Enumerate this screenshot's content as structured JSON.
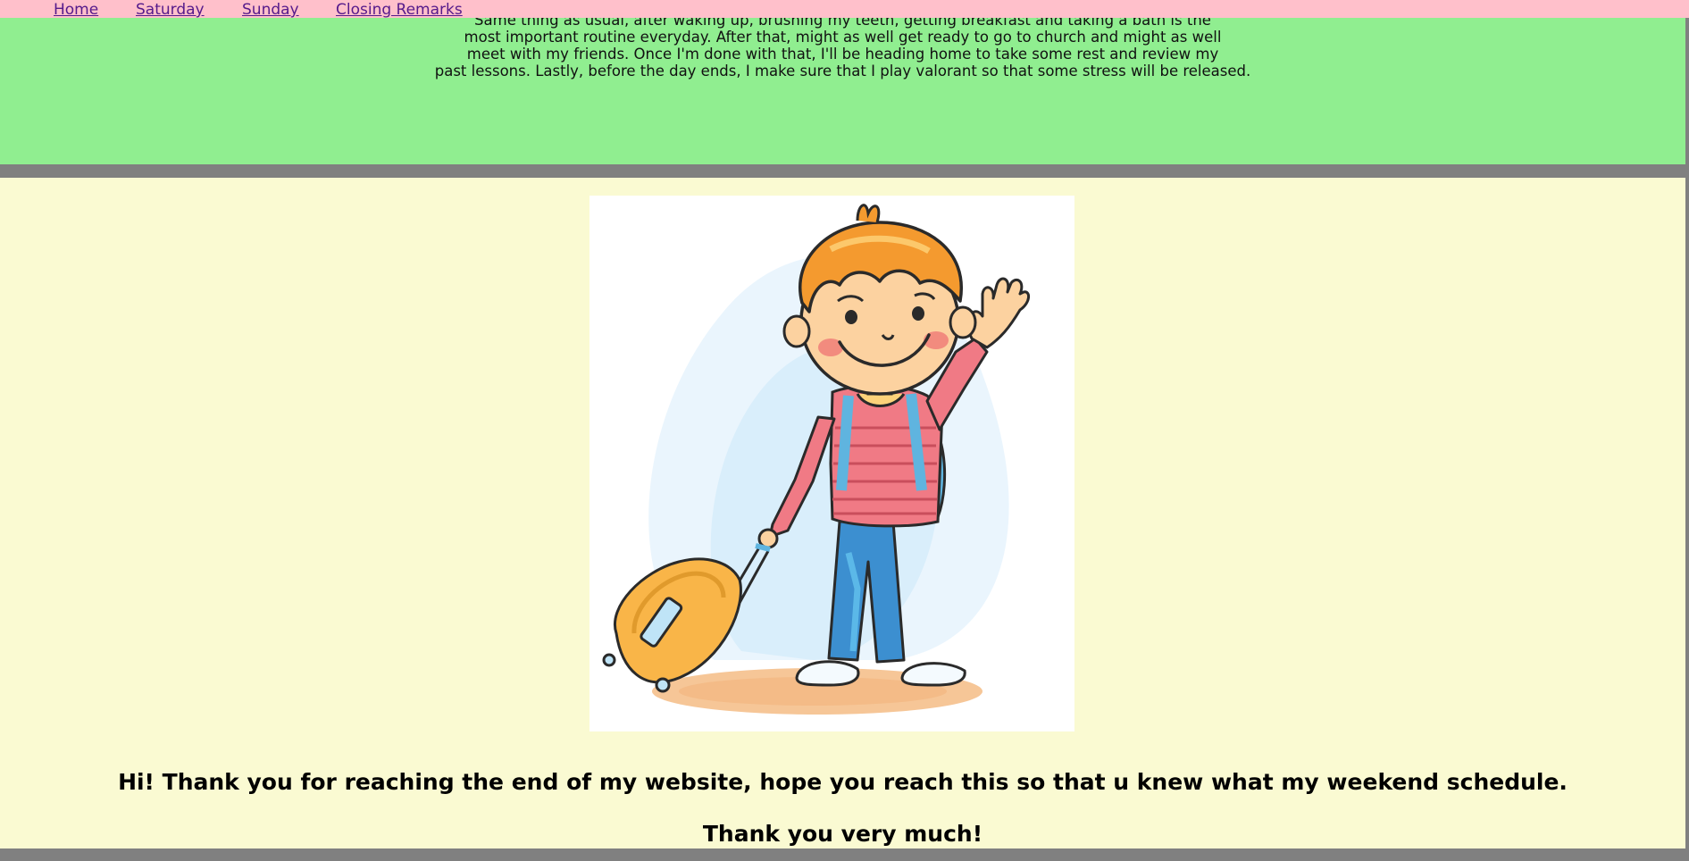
{
  "nav": {
    "items": [
      {
        "label": "Home"
      },
      {
        "label": "Saturday"
      },
      {
        "label": "Sunday"
      },
      {
        "label": "Closing Remarks"
      }
    ]
  },
  "sunday": {
    "lines": [
      "Same thing as usual, after waking up, brushing my teeth, getting breakfast and taking a bath is the",
      "most important routine everyday. After that, might as well get ready to go to church and might as well",
      "meet with my friends. Once I'm done with that, I'll be heading home to take some rest and review my",
      "past lessons. Lastly, before the day ends, I make sure that I play valorant so that some stress will be released."
    ]
  },
  "closing": {
    "message": "Hi! Thank you for reaching the end of my website, hope you reach this so that u knew what my weekend schedule.",
    "thanks": "Thank you very much!"
  },
  "colors": {
    "nav_bg": "#FFC0CB",
    "green_bg": "#90EE90",
    "cream_bg": "#FAFAD2",
    "separator": "#808080",
    "link": "#551A8B"
  },
  "illustration": {
    "icon": "boy-with-suitcase-waving-illustration"
  }
}
